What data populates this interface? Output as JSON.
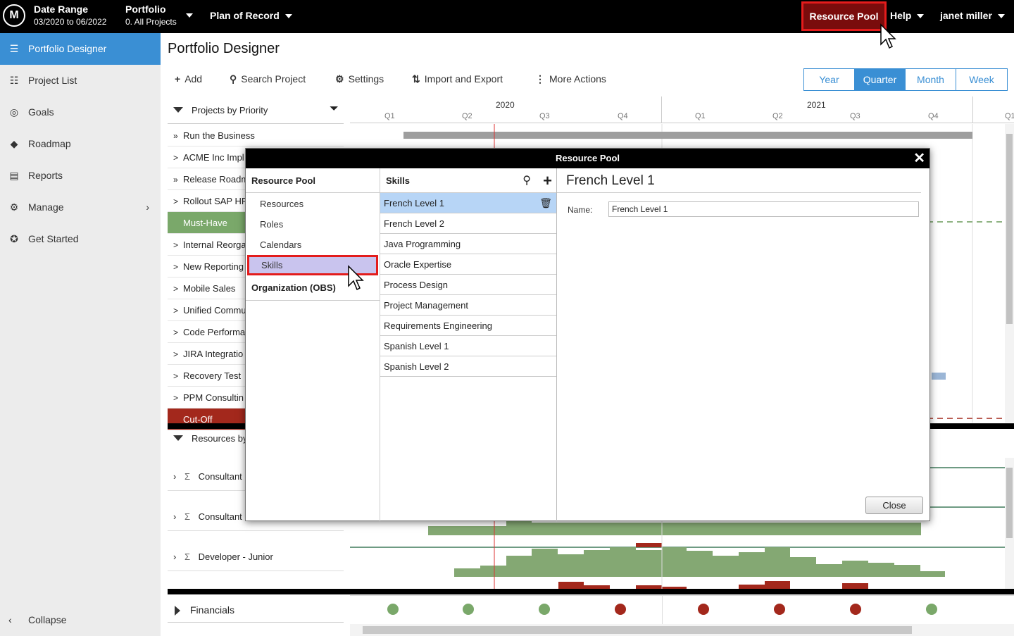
{
  "topbar": {
    "logo": "M",
    "date_range_label": "Date Range",
    "date_range_value": "03/2020 to 06/2022",
    "portfolio_label": "Portfolio",
    "portfolio_value": "0. All Projects",
    "plan": "Plan of Record",
    "resource_pool": "Resource Pool",
    "help": "Help",
    "user": "janet miller"
  },
  "sidebar": {
    "items": [
      {
        "label": "Portfolio Designer",
        "icon": "menu-lines-icon"
      },
      {
        "label": "Project List",
        "icon": "list-icon"
      },
      {
        "label": "Goals",
        "icon": "target-icon"
      },
      {
        "label": "Roadmap",
        "icon": "diamond-icon"
      },
      {
        "label": "Reports",
        "icon": "document-icon"
      },
      {
        "label": "Manage",
        "icon": "gear-icon"
      },
      {
        "label": "Get Started",
        "icon": "compass-icon"
      }
    ],
    "collapse": "Collapse"
  },
  "main": {
    "title": "Portfolio Designer",
    "toolbar": {
      "add": "Add",
      "search": "Search Project",
      "settings": "Settings",
      "import_export": "Import and Export",
      "more": "More Actions"
    },
    "views": [
      "Year",
      "Quarter",
      "Month",
      "Week"
    ],
    "selected_view": "Quarter",
    "projects_header": "Projects by Priority",
    "projects": [
      {
        "name": "Run the Business",
        "arrow": "»",
        "style": "normal"
      },
      {
        "name": "ACME Inc Impl",
        "arrow": ">",
        "style": "normal"
      },
      {
        "name": "Release Roadm",
        "arrow": "»",
        "style": "normal"
      },
      {
        "name": "Rollout SAP HF",
        "arrow": ">",
        "style": "normal"
      },
      {
        "name": "Must-Have",
        "arrow": "",
        "style": "green"
      },
      {
        "name": "Internal Reorga",
        "arrow": ">",
        "style": "normal"
      },
      {
        "name": "New Reporting",
        "arrow": ">",
        "style": "normal"
      },
      {
        "name": "Mobile Sales",
        "arrow": ">",
        "style": "normal"
      },
      {
        "name": "Unified Commu",
        "arrow": ">",
        "style": "normal"
      },
      {
        "name": "Code Performa",
        "arrow": ">",
        "style": "normal"
      },
      {
        "name": "JIRA Integratio",
        "arrow": ">",
        "style": "normal"
      },
      {
        "name": "Recovery Test",
        "arrow": ">",
        "style": "normal"
      },
      {
        "name": "PPM Consultin",
        "arrow": ">",
        "style": "normal"
      },
      {
        "name": "Cut-Off",
        "arrow": "",
        "style": "red"
      }
    ],
    "resources_header": "Resources by",
    "resources": [
      "Consultant",
      "Consultant",
      "Developer - Junior"
    ],
    "financials": "Financials",
    "timeline": {
      "years": [
        "2020",
        "2021"
      ],
      "quarters": [
        "Q1",
        "Q2",
        "Q3",
        "Q4",
        "Q1",
        "Q2",
        "Q3",
        "Q4",
        "Q1"
      ]
    },
    "financial_dots": [
      "#7aa86a",
      "#7aa86a",
      "#7aa86a",
      "#a3281c",
      "#a3281c",
      "#a3281c",
      "#a3281c",
      "#7aa86a"
    ]
  },
  "modal": {
    "title": "Resource Pool",
    "nav_header": "Resource Pool",
    "nav_items": [
      "Resources",
      "Roles",
      "Calendars",
      "Skills"
    ],
    "nav_selected": "Skills",
    "obs": "Organization (OBS)",
    "skills_header": "Skills",
    "skills": [
      "French Level 1",
      "French Level 2",
      "Java Programming",
      "Oracle Expertise",
      "Process Design",
      "Project Management",
      "Requirements Engineering",
      "Spanish Level 1",
      "Spanish Level 2"
    ],
    "selected_skill": "French Level 1",
    "detail_title": "French Level 1",
    "name_label": "Name:",
    "name_value": "French Level 1",
    "close": "Close"
  }
}
